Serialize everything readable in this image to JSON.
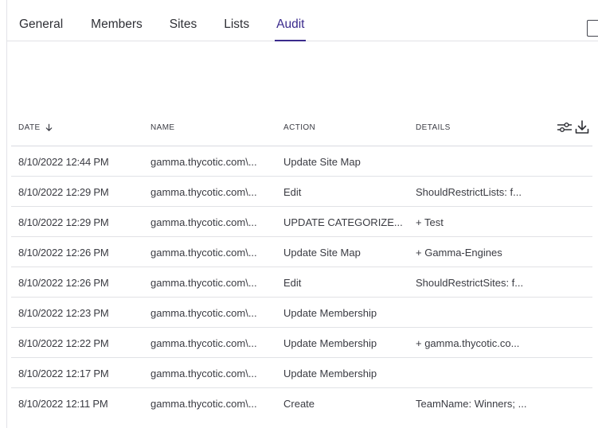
{
  "tabs": [
    {
      "label": "General",
      "active": false
    },
    {
      "label": "Members",
      "active": false
    },
    {
      "label": "Sites",
      "active": false
    },
    {
      "label": "Lists",
      "active": false
    },
    {
      "label": "Audit",
      "active": true
    }
  ],
  "audit": {
    "columns": {
      "date": "DATE",
      "name": "NAME",
      "action": "ACTION",
      "details": "DETAILS"
    },
    "sort": {
      "column": "date",
      "direction": "descending"
    },
    "tools": {
      "filter_icon": "sliders-icon",
      "export_icon": "download-icon"
    },
    "rows": [
      {
        "date": "8/10/2022 12:44 PM",
        "name": "gamma.thycotic.com\\...",
        "action": "Update Site Map",
        "details": ""
      },
      {
        "date": "8/10/2022 12:29 PM",
        "name": "gamma.thycotic.com\\...",
        "action": "Edit",
        "details": "ShouldRestrictLists: f..."
      },
      {
        "date": "8/10/2022 12:29 PM",
        "name": "gamma.thycotic.com\\...",
        "action": "UPDATE CATEGORIZE...",
        "details": "+ Test"
      },
      {
        "date": "8/10/2022 12:26 PM",
        "name": "gamma.thycotic.com\\...",
        "action": "Update Site Map",
        "details": "+ Gamma-Engines"
      },
      {
        "date": "8/10/2022 12:26 PM",
        "name": "gamma.thycotic.com\\...",
        "action": "Edit",
        "details": "ShouldRestrictSites: f..."
      },
      {
        "date": "8/10/2022 12:23 PM",
        "name": "gamma.thycotic.com\\...",
        "action": "Update Membership",
        "details": ""
      },
      {
        "date": "8/10/2022 12:22 PM",
        "name": "gamma.thycotic.com\\...",
        "action": "Update Membership",
        "details": "+ gamma.thycotic.co..."
      },
      {
        "date": "8/10/2022 12:17 PM",
        "name": "gamma.thycotic.com\\...",
        "action": "Update Membership",
        "details": ""
      },
      {
        "date": "8/10/2022 12:11 PM",
        "name": "gamma.thycotic.com\\...",
        "action": "Create",
        "details": "TeamName: Winners; ..."
      }
    ]
  },
  "colors": {
    "accent": "#3a2a8c",
    "text": "#3a3b42",
    "divider": "#e1e2e6"
  }
}
